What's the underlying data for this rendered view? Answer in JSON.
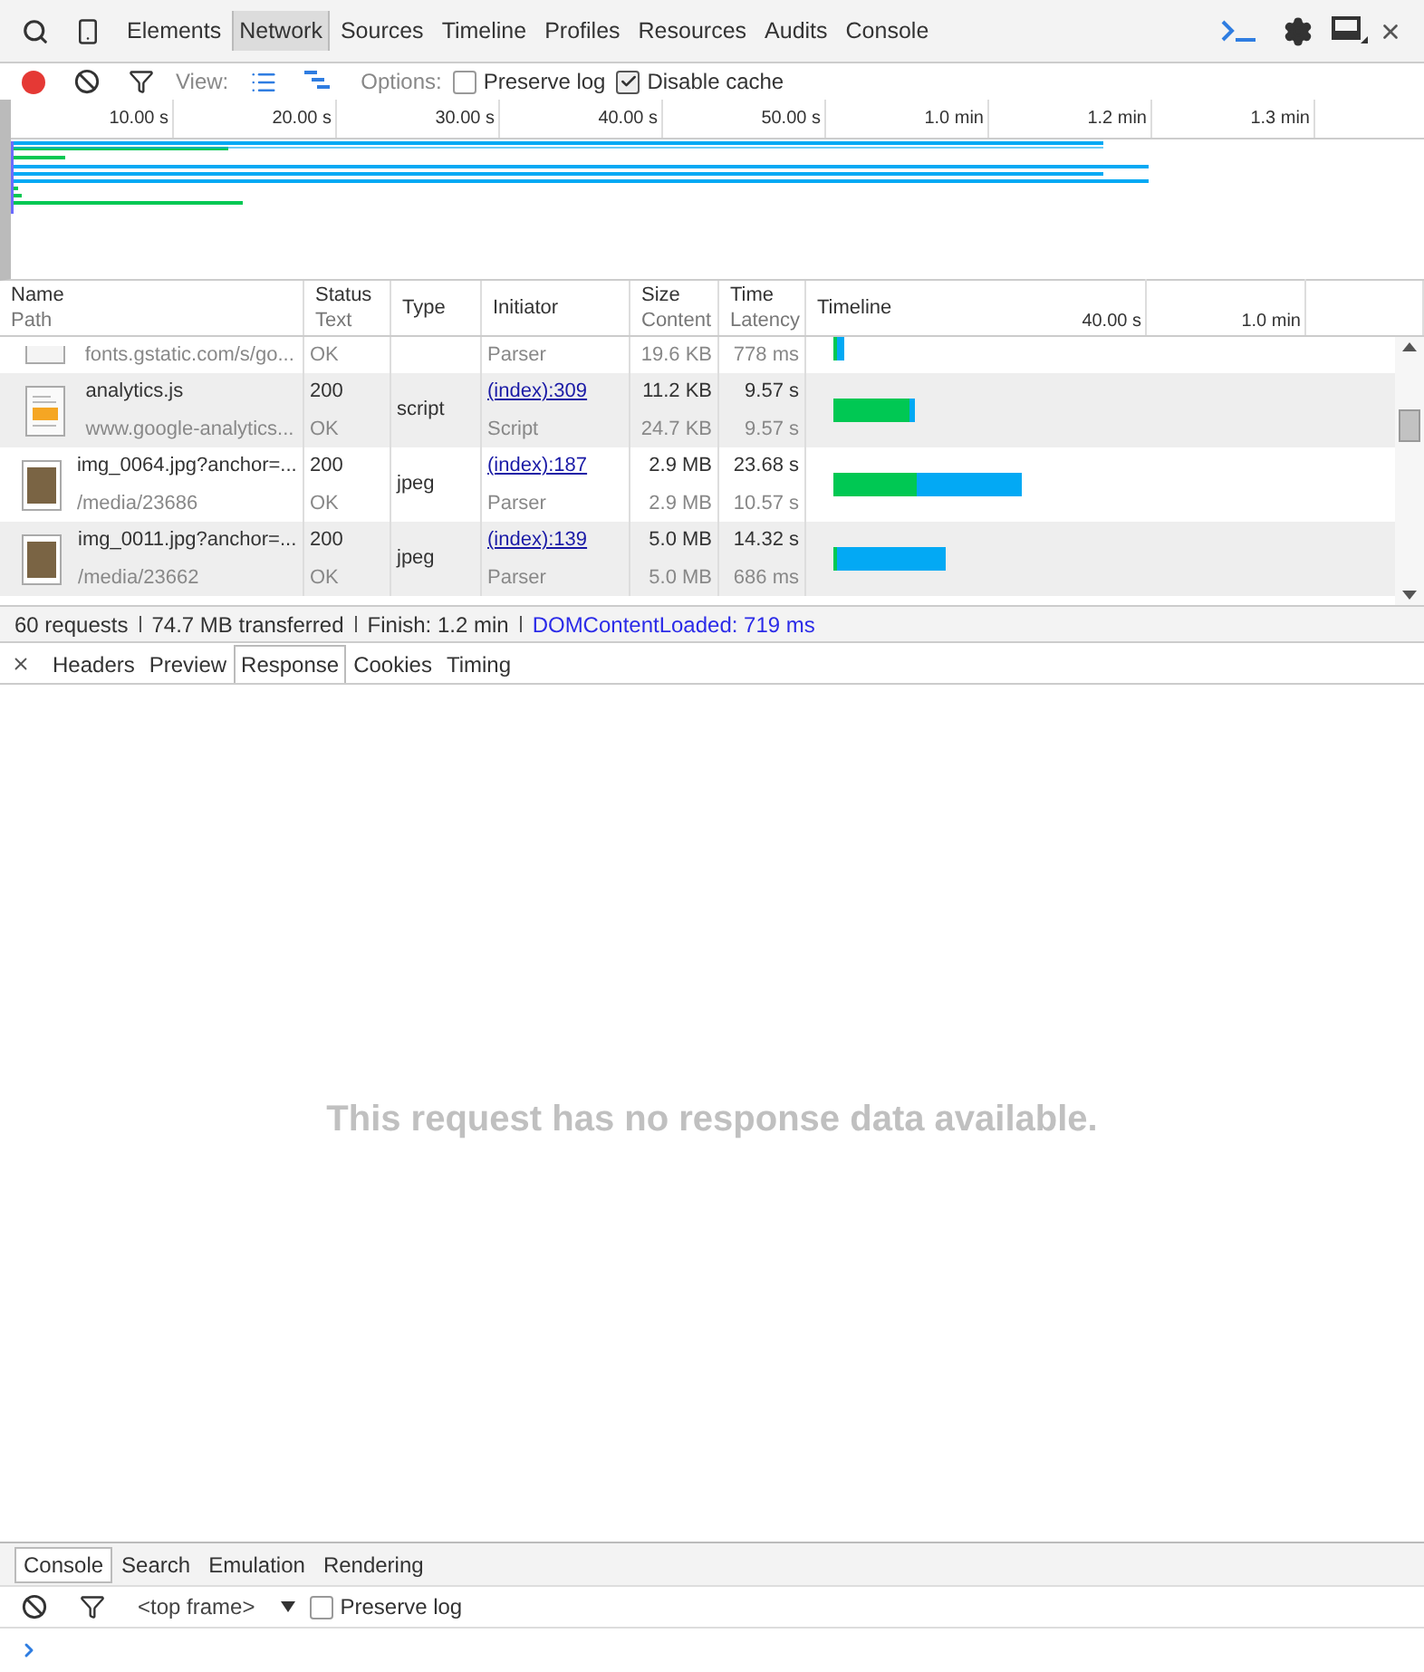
{
  "main_tabs": [
    {
      "label": "Elements",
      "selected": false
    },
    {
      "label": "Network",
      "selected": true
    },
    {
      "label": "Sources",
      "selected": false
    },
    {
      "label": "Timeline",
      "selected": false
    },
    {
      "label": "Profiles",
      "selected": false
    },
    {
      "label": "Resources",
      "selected": false
    },
    {
      "label": "Audits",
      "selected": false
    },
    {
      "label": "Console",
      "selected": false
    }
  ],
  "network_toolbar": {
    "recording": true,
    "view_label": "View:",
    "options_label": "Options:",
    "options": [
      {
        "label": "Preserve log",
        "checked": false
      },
      {
        "label": "Disable cache",
        "checked": true
      }
    ]
  },
  "overview": {
    "ticks": [
      "10.00 s",
      "20.00 s",
      "30.00 s",
      "40.00 s",
      "50.00 s",
      "1.0 min",
      "1.2 min",
      "1.3 min"
    ]
  },
  "table": {
    "columns": [
      {
        "title": "Name",
        "subtitle": "Path"
      },
      {
        "title": "Status",
        "subtitle": "Text"
      },
      {
        "title": "Type"
      },
      {
        "title": "Initiator"
      },
      {
        "title": "Size",
        "subtitle": "Content"
      },
      {
        "title": "Time",
        "subtitle": "Latency"
      },
      {
        "title": "Timeline"
      }
    ],
    "timeline_ticks": [
      "40.00 s",
      "1.0 min"
    ],
    "rows": [
      {
        "kind": "font",
        "path": "fonts.gstatic.com/s/go...",
        "status_text": "OK",
        "initiator_detail": "Parser",
        "content": "19.6 KB",
        "latency": "778 ms"
      },
      {
        "kind": "script",
        "name": "analytics.js",
        "path": "www.google-analytics...",
        "status": "200",
        "status_text": "OK",
        "type": "script",
        "initiator": "(index):309",
        "initiator_detail": "Script",
        "size": "11.2 KB",
        "content": "24.7 KB",
        "time": "9.57 s",
        "latency": "9.57 s"
      },
      {
        "kind": "image",
        "name": "img_0064.jpg?anchor=...",
        "path": "/media/23686",
        "status": "200",
        "status_text": "OK",
        "type": "jpeg",
        "initiator": "(index):187",
        "initiator_detail": "Parser",
        "size": "2.9 MB",
        "content": "2.9 MB",
        "time": "23.68 s",
        "latency": "10.57 s"
      },
      {
        "kind": "image",
        "name": "img_0011.jpg?anchor=...",
        "path": "/media/23662",
        "status": "200",
        "status_text": "OK",
        "type": "jpeg",
        "initiator": "(index):139",
        "initiator_detail": "Parser",
        "size": "5.0 MB",
        "content": "5.0 MB",
        "time": "14.32 s",
        "latency": "686 ms"
      }
    ]
  },
  "summary": [
    "60 requests",
    "74.7 MB transferred",
    "Finish: 1.2 min",
    "DOMContentLoaded: 719 ms"
  ],
  "detail_tabs": [
    {
      "label": "Headers",
      "selected": false
    },
    {
      "label": "Preview",
      "selected": false
    },
    {
      "label": "Response",
      "selected": true
    },
    {
      "label": "Cookies",
      "selected": false
    },
    {
      "label": "Timing",
      "selected": false
    }
  ],
  "response_message": "This request has no response data available.",
  "drawer_tabs": [
    {
      "label": "Console",
      "selected": true
    },
    {
      "label": "Search",
      "selected": false
    },
    {
      "label": "Emulation",
      "selected": false
    },
    {
      "label": "Rendering",
      "selected": false
    }
  ],
  "console_toolbar": {
    "frame": "<top frame>",
    "preserve_log": {
      "label": "Preserve log",
      "checked": false
    }
  }
}
